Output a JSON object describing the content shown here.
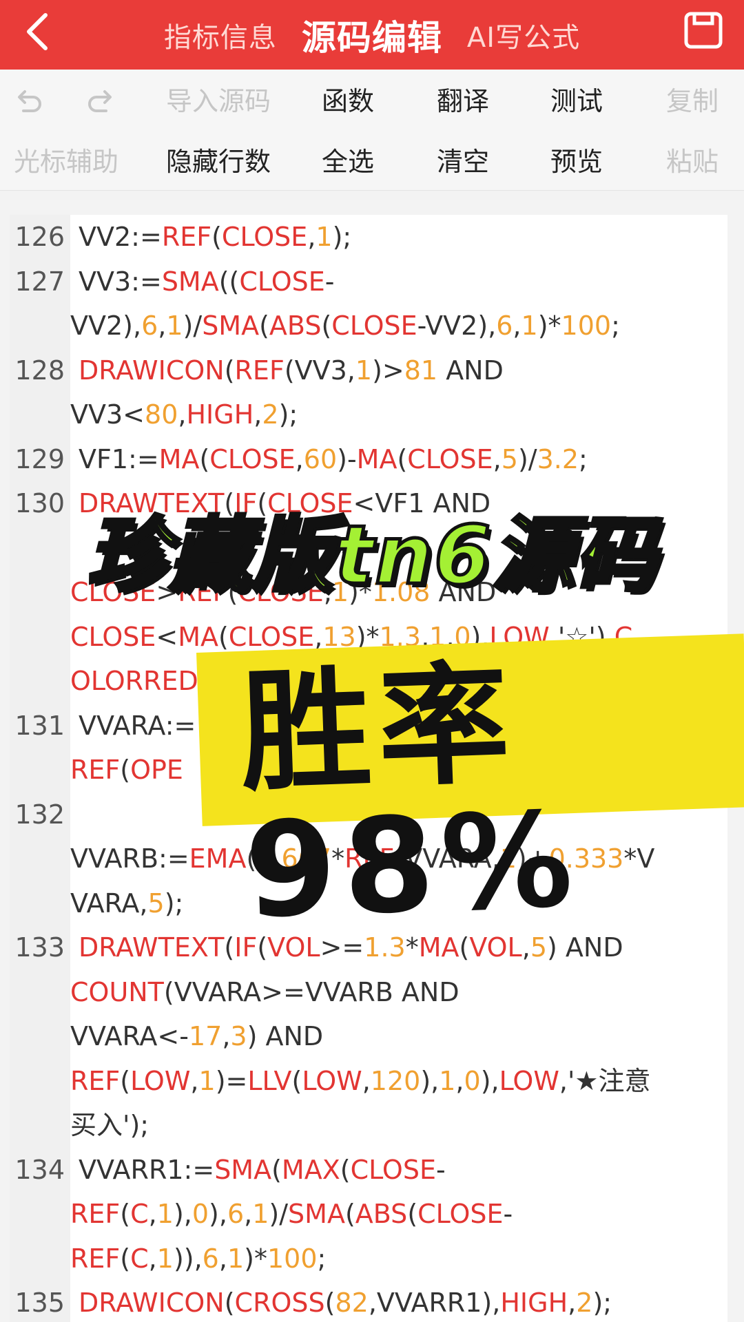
{
  "header": {
    "tabs": [
      "指标信息",
      "源码编辑",
      "AI写公式"
    ],
    "active_tab": "源码编辑"
  },
  "toolbar": {
    "row1": [
      "导入源码",
      "函数",
      "翻译",
      "测试",
      "复制"
    ],
    "row2": [
      "光标辅助",
      "隐藏行数",
      "全选",
      "清空",
      "预览",
      "粘贴"
    ]
  },
  "code_lines": [
    {
      "no": "126",
      "text": "VV2:=REF(CLOSE,1);"
    },
    {
      "no": "127",
      "text": "VV3:=SMA((CLOSE-"
    },
    {
      "no": "",
      "text": "VV2),6,1)/SMA(ABS(CLOSE-VV2),6,1)*100;"
    },
    {
      "no": "128",
      "text": "DRAWICON(REF(VV3,1)>81 AND"
    },
    {
      "no": "",
      "text": "VV3<80,HIGH,2);"
    },
    {
      "no": "129",
      "text": "VF1:=MA(CLOSE,60)-MA(CLOSE,5)/3.2;"
    },
    {
      "no": "130",
      "text": "DRAWTEXT(IF(CLOSE<VF1 AND"
    },
    {
      "no": "",
      "text": ""
    },
    {
      "no": "",
      "text": "CLOSE>REF(CLOSE,1)*1.08 AND"
    },
    {
      "no": "",
      "text": "CLOSE<MA(CLOSE,13)*1.3,1,0),LOW,'☆'),C"
    },
    {
      "no": "",
      "text": "OLORRED;"
    },
    {
      "no": "131",
      "text": "VVARA:="
    },
    {
      "no": "",
      "text": "REF(OPE"
    },
    {
      "no": "132",
      "text": ""
    },
    {
      "no": "",
      "text": "VVARB:=EMA(0.667*REF(VVARA,1)+0.333*V"
    },
    {
      "no": "",
      "text": "VARA,5);"
    },
    {
      "no": "133",
      "text": "DRAWTEXT(IF(VOL>=1.3*MA(VOL,5) AND"
    },
    {
      "no": "",
      "text": "COUNT(VVARA>=VVARB AND"
    },
    {
      "no": "",
      "text": "VVARA<-17,3) AND"
    },
    {
      "no": "",
      "text": "REF(LOW,1)=LLV(LOW,120),1,0),LOW,'★注意"
    },
    {
      "no": "",
      "text": "买入');"
    },
    {
      "no": "134",
      "text": "VVARR1:=SMA(MAX(CLOSE-"
    },
    {
      "no": "",
      "text": "REF(C,1),0),6,1)/SMA(ABS(CLOSE-"
    },
    {
      "no": "",
      "text": "REF(C,1)),6,1)*100;"
    },
    {
      "no": "135",
      "text": "DRAWICON(CROSS(82,VVARR1),HIGH,2);"
    }
  ],
  "banner_title": "珍藏版tn6源码",
  "banner_rate": "胜率98%",
  "colors": {
    "header": "#e93c39",
    "func": "#e23532",
    "number": "#f0a030",
    "banner_green": "#a4f034",
    "banner_yellow": "#f4e31d"
  }
}
